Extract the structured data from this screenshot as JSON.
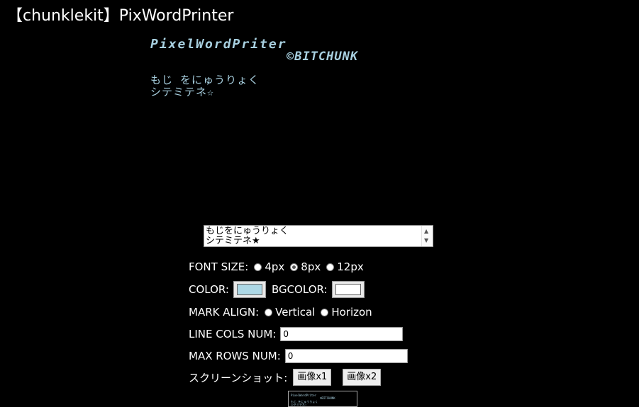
{
  "page": {
    "title": "【chunklekit】PixWordPrinter"
  },
  "pixel_canvas": {
    "title": "PixelWordPriter",
    "credit": "©BITCHUNK",
    "line1": "もじ をにゅうりょく",
    "line2": "シテミテネ☆",
    "text_color": "#a8d0e0"
  },
  "text_input": {
    "lines": [
      "もじをにゅうりょく",
      "シテミテネ★"
    ]
  },
  "font_size": {
    "label": "FONT SIZE:",
    "options": [
      {
        "label": "4px",
        "checked": false
      },
      {
        "label": "8px",
        "checked": true
      },
      {
        "label": "12px",
        "checked": false
      }
    ]
  },
  "color": {
    "label": "COLOR:",
    "value": "#add8e6",
    "bg_label": "BGCOLOR:",
    "bg_value": "#ffffff"
  },
  "mark_align": {
    "label": "MARK ALIGN:",
    "options": [
      {
        "label": "Vertical",
        "checked": false
      },
      {
        "label": "Horizon",
        "checked": false
      }
    ]
  },
  "line_cols": {
    "label": "LINE COLS NUM:",
    "value": "0"
  },
  "max_rows": {
    "label": "MAX ROWS NUM:",
    "value": "0"
  },
  "screenshot": {
    "label": "スクリーンショット:",
    "btn1": "画像x1",
    "btn2": "画像x2"
  },
  "preview": {
    "title": "PixelWordPriter",
    "credit": "©BITCHUNK",
    "line1": "もじ をにゅうりょく",
    "line2": "シテミテネ☆"
  }
}
